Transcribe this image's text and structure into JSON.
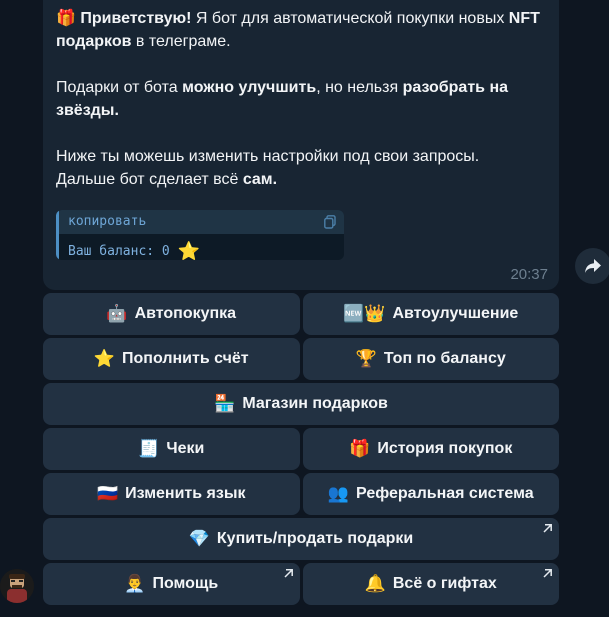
{
  "message": {
    "p1_emoji": "🎁",
    "p1_bold": "Приветствую!",
    "p1_text1": " Я бот для автоматической покупки новых ",
    "p1_bold2": "NFT подарков",
    "p1_text2": " в телеграме.",
    "p2_text1": "Подарки от бота ",
    "p2_bold1": "можно улучшить",
    "p2_text2": ", но нельзя ",
    "p2_bold2": "разобрать на звёзды.",
    "p3_line1": "Ниже ты можешь изменить настройки под свои запросы.",
    "p3_text": "Дальше бот сделает всё ",
    "p3_bold": "сам."
  },
  "code": {
    "lang": "копировать",
    "line": "Ваш баланс: 0 ",
    "star": "⭐"
  },
  "time": "20:37",
  "buttons": [
    {
      "icon": "🤖",
      "label": "Автопокупка"
    },
    {
      "icon": "🆕👑",
      "label": "Автоулучшение"
    },
    {
      "icon": "⭐",
      "label": "Пополнить счёт"
    },
    {
      "icon": "🏆",
      "label": "Топ по балансу"
    },
    {
      "icon": "🏪",
      "label": "Магазин подарков"
    },
    {
      "icon": "🧾",
      "label": "Чеки"
    },
    {
      "icon": "🎁",
      "label": "История покупок"
    },
    {
      "icon": "🇷🇺",
      "label": "Изменить язык"
    },
    {
      "icon": "👥",
      "label": "Реферальная система"
    },
    {
      "icon": "💎",
      "label": "Купить/продать подарки"
    },
    {
      "icon": "👨‍💼",
      "label": "Помощь"
    },
    {
      "icon": "🔔",
      "label": "Всё о гифтах"
    }
  ],
  "colors": {
    "background": "#0e1621",
    "bubble": "#182533",
    "button": "#223142",
    "code_accent": "#4d8fc4"
  }
}
